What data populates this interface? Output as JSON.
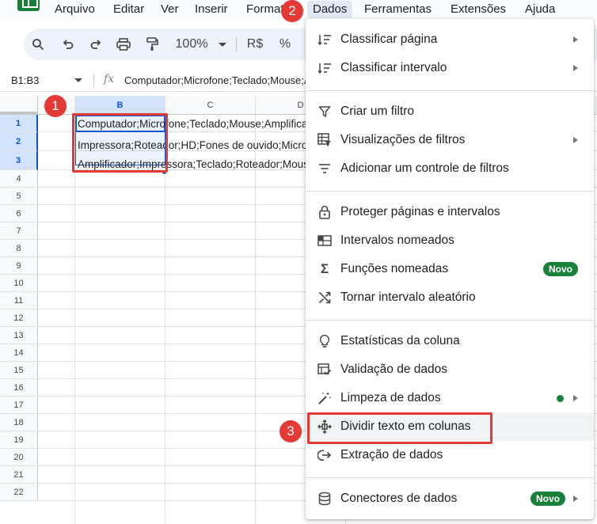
{
  "menu": {
    "items": [
      "Arquivo",
      "Editar",
      "Ver",
      "Inserir",
      "Formatar",
      "Dados",
      "Ferramentas",
      "Extensões",
      "Ajuda"
    ],
    "active": "Dados"
  },
  "toolbar": {
    "zoom": "100%",
    "currency": "R$"
  },
  "formula_bar": {
    "name_box": "B1:B3",
    "fx": "fx",
    "formula": "Computador;Microfone;Teclado;Mouse;Amplificador"
  },
  "grid": {
    "columns": [
      "B",
      "C",
      "D"
    ],
    "rows": [
      "1",
      "2",
      "3",
      "4",
      "5",
      "6",
      "7",
      "8",
      "9",
      "10",
      "11",
      "12",
      "13",
      "14",
      "15",
      "16",
      "17",
      "18",
      "19",
      "20",
      "21",
      "22"
    ],
    "cells": [
      "Computador;Microfone;Teclado;Mouse;Amplificador",
      "Impressora;Roteador;HD;Fones de ouvido;Microfone",
      "Amplificador;Impressora;Teclado;Roteador;Mouse"
    ]
  },
  "badges": [
    "1",
    "2",
    "3"
  ],
  "dropdown": {
    "items": [
      {
        "label": "Classificar página",
        "icon": "sort-icon",
        "submenu": true
      },
      {
        "label": "Classificar intervalo",
        "icon": "sort-icon",
        "submenu": true
      },
      {
        "label": "Criar um filtro",
        "icon": "filter-icon",
        "submenu": false
      },
      {
        "label": "Visualizações de filtros",
        "icon": "filter-views-icon",
        "submenu": true
      },
      {
        "label": "Adicionar um controle de filtros",
        "icon": "filter-list-icon",
        "submenu": false
      },
      {
        "label": "Proteger páginas e intervalos",
        "icon": "lock-icon",
        "submenu": false
      },
      {
        "label": "Intervalos nomeados",
        "icon": "named-ranges-icon",
        "submenu": false
      },
      {
        "label": "Funções nomeadas",
        "icon": "sigma-icon",
        "submenu": false,
        "badge": "Novo"
      },
      {
        "label": "Tornar intervalo aleatório",
        "icon": "shuffle-icon",
        "submenu": false
      },
      {
        "label": "Estatísticas da coluna",
        "icon": "lightbulb-icon",
        "submenu": false
      },
      {
        "label": "Validação de dados",
        "icon": "validation-icon",
        "submenu": false
      },
      {
        "label": "Limpeza de dados",
        "icon": "magic-wand-icon",
        "submenu": true
      },
      {
        "label": "Dividir texto em colunas",
        "icon": "split-columns-icon",
        "submenu": false
      },
      {
        "label": "Extração de dados",
        "icon": "extract-icon",
        "submenu": false
      },
      {
        "label": "Conectores de dados",
        "icon": "database-icon",
        "submenu": true,
        "badge": "Novo"
      }
    ]
  },
  "colors": {
    "accent": "#0b57d0",
    "highlight_red": "#e53935",
    "badge_green": "#188038"
  }
}
